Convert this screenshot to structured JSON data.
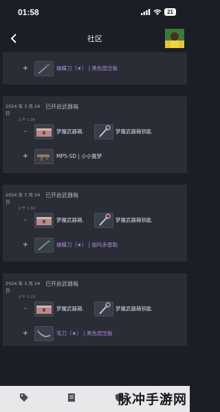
{
  "status": {
    "time": "01:58",
    "battery": "21"
  },
  "nav": {
    "title": "社区"
  },
  "top_partial": {
    "sign": "+",
    "item": {
      "name": "蝴蝶刀（★）",
      "detail": " | 黑色层压板"
    }
  },
  "cards": [
    {
      "date": "2024 年 3 月 24 日",
      "time": "上午 1:36",
      "event": "已开启武器箱",
      "minus_sign": "-",
      "consumed": [
        "梦魔武器箱.",
        "梦魔武器箱钥匙"
      ],
      "plus_sign": "+",
      "received": {
        "name": "MP5-SD",
        "detail": " | 小小噩梦",
        "color": "white"
      }
    },
    {
      "date": "2024 年 3 月 24 日",
      "time": "上午 1:30",
      "event": "已开启武器箱",
      "minus_sign": "-",
      "consumed": [
        "梦魔武器箱.",
        "梦魔武器箱钥匙"
      ],
      "plus_sign": "+",
      "received": {
        "name": "蝴蝶刀（★）",
        "detail": " | 伽玛多普勒",
        "color": "purple"
      }
    },
    {
      "date": "2024 年 3 月 24 日",
      "time": "上午 1:29",
      "event": "已开启武器箱",
      "minus_sign": "-",
      "consumed": [
        "梦魔武器箱.",
        "梦魔武器箱钥匙"
      ],
      "plus_sign": "+",
      "received": {
        "name": "弯刀（★）",
        "detail": " | 黑色层压板",
        "color": "purple"
      }
    }
  ],
  "tabbar": {
    "icons": [
      "tag-icon",
      "inventory-icon",
      "shield-icon",
      "user-icon"
    ]
  },
  "watermark": "脉冲手游网",
  "colors": {
    "background": "#1b1e25",
    "card": "#2a2d36",
    "rare_purple": "#a98bd8",
    "tabbar": "#e8e8ea"
  }
}
